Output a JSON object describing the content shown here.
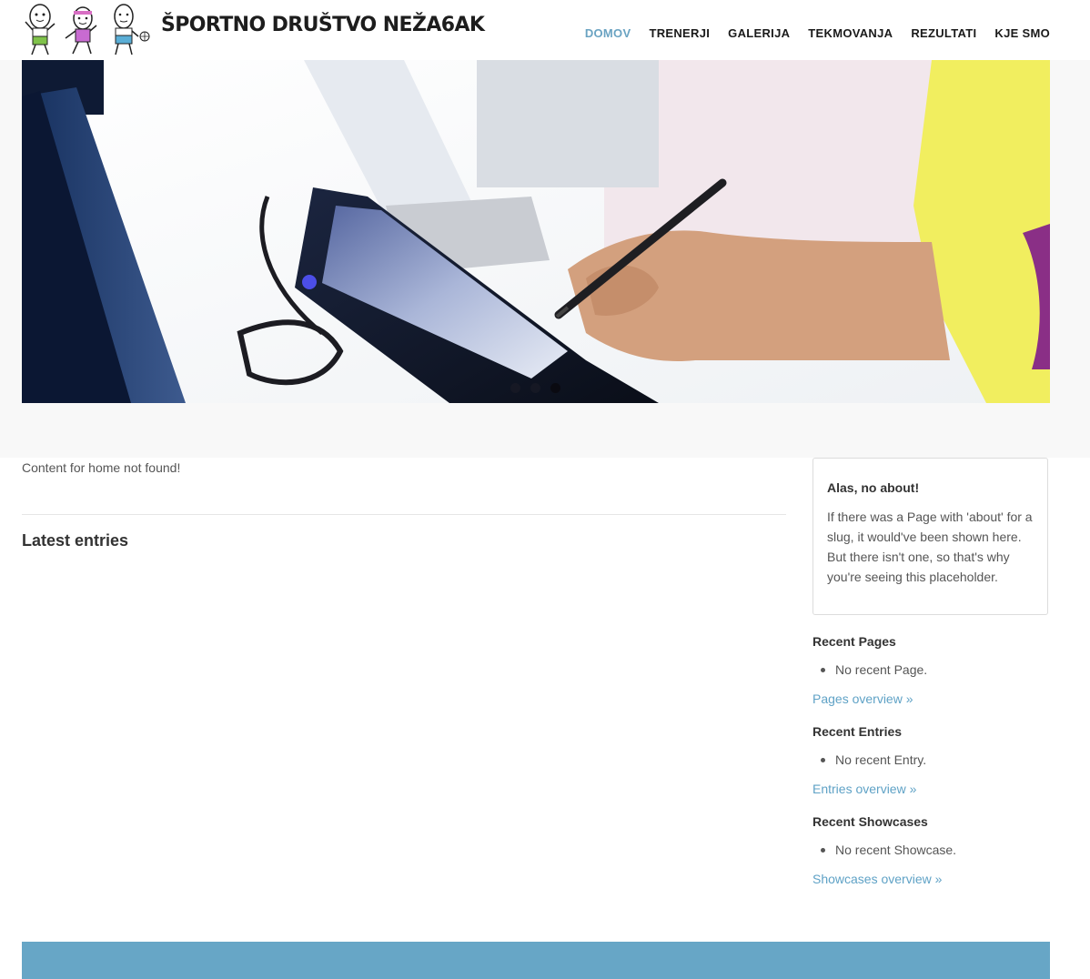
{
  "site": {
    "title": "ŠPORTNO DRUŠTVO NEŽA6AK"
  },
  "nav": {
    "items": [
      {
        "label": "DOMOV",
        "active": true
      },
      {
        "label": "TRENERJI",
        "active": false
      },
      {
        "label": "GALERIJA",
        "active": false
      },
      {
        "label": "TEKMOVANJA",
        "active": false
      },
      {
        "label": "REZULTATI",
        "active": false
      },
      {
        "label": "KJE SMO",
        "active": false
      }
    ]
  },
  "slider": {
    "dot_count": 3,
    "active_index": 2
  },
  "main": {
    "note": "Content for home not found!",
    "latest_heading": "Latest entries"
  },
  "sidebar": {
    "about": {
      "title": "Alas, no about!",
      "text": "If there was a Page with 'about' for a slug, it would've been shown here. But there isn't one, so that's why you're seeing this placeholder."
    },
    "pages": {
      "title": "Recent Pages",
      "item": "No recent Page.",
      "link": "Pages overview »"
    },
    "entries": {
      "title": "Recent Entries",
      "item": "No recent Entry.",
      "link": "Entries overview »"
    },
    "showcases": {
      "title": "Recent Showcases",
      "item": "No recent Showcase.",
      "link": "Showcases overview »"
    }
  },
  "colors": {
    "accent": "#6aa3c2",
    "link": "#5fa2c6",
    "footer": "#67a6c6",
    "shirt": "#f1ee5f"
  }
}
